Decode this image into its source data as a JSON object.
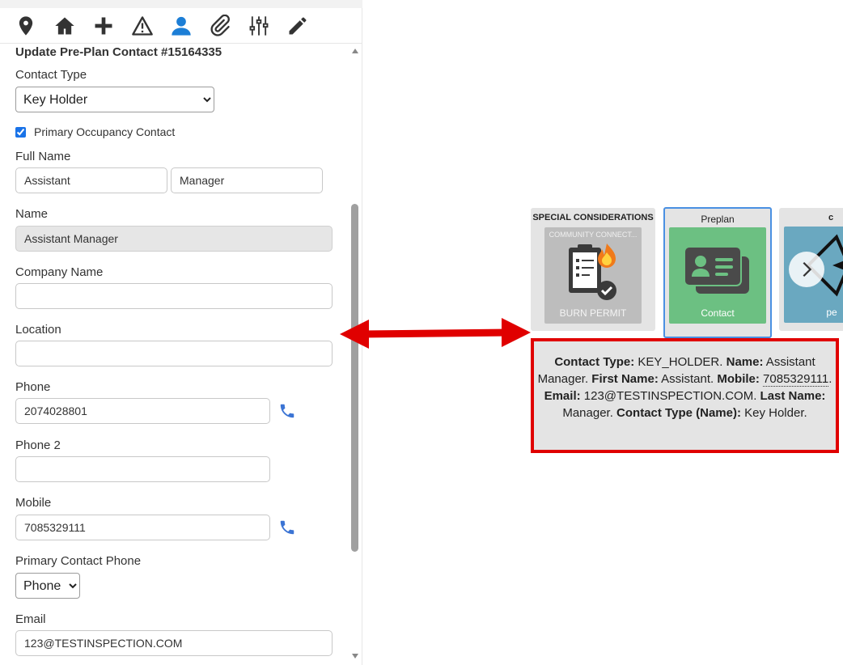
{
  "toolbar": {
    "icons": [
      "location-pin-icon",
      "home-icon",
      "plus-icon",
      "warning-icon",
      "person-icon",
      "paperclip-icon",
      "sliders-icon",
      "pencil-icon"
    ],
    "active_icon": "person-icon",
    "active_color": "#1c7ed6",
    "icon_color": "#333333"
  },
  "form": {
    "title": "Update Pre-Plan Contact #15164335",
    "contact_type_label": "Contact Type",
    "contact_type_value": "Key Holder",
    "primary_occupancy_label": "Primary Occupancy Contact",
    "primary_occupancy_checked": true,
    "full_name_label": "Full Name",
    "first_name_value": "Assistant",
    "last_name_value": "Manager",
    "name_label": "Name",
    "name_value": "Assistant Manager",
    "company_label": "Company Name",
    "company_value": "",
    "location_label": "Location",
    "location_value": "",
    "phone_label": "Phone",
    "phone_value": "2074028801",
    "phone2_label": "Phone 2",
    "phone2_value": "",
    "mobile_label": "Mobile",
    "mobile_value": "7085329111",
    "primary_phone_label": "Primary Contact Phone",
    "primary_phone_value": "Phone",
    "email_label": "Email",
    "email_value": "123@TESTINSPECTION.COM"
  },
  "cards": {
    "special": {
      "title": "SPECIAL CONSIDERATIONS",
      "subtitle": "COMMUNITY CONNECT...",
      "label": "BURN PERMIT",
      "tile_color": "#bdbdbd"
    },
    "preplan": {
      "title": "Preplan",
      "label": "Contact",
      "tile_color": "#6cc082",
      "border_color": "#4a90e2"
    },
    "third": {
      "title": "c",
      "label": "pe",
      "tile_color": "#6aa8c0"
    }
  },
  "tooltip": {
    "contact_type_key": "Contact Type:",
    "contact_type_val": " KEY_HOLDER.",
    "name_key": "Name:",
    "name_val": " Assistant Manager.",
    "first_name_key": "First Name:",
    "first_name_val": " Assistant.",
    "mobile_key": "Mobile:",
    "mobile_val": "7085329111",
    "email_key": "Email:",
    "email_val": " 123@TESTINSPECTION.COM.",
    "last_name_key": "Last Name:",
    "last_name_val": " Manager.",
    "contact_type_name_key": "Contact Type (Name):",
    "contact_type_name_val": " Key Holder."
  },
  "annotation_color": "#e00000"
}
